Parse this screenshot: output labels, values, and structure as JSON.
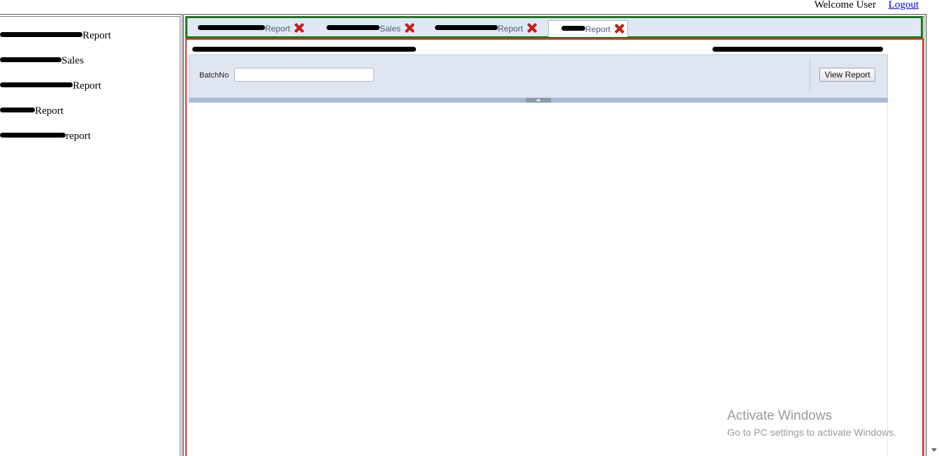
{
  "header": {
    "welcome": "Welcome User",
    "logout": "Logout"
  },
  "sidebar": {
    "items": [
      {
        "label": "Report"
      },
      {
        "label": "Sales"
      },
      {
        "label": "Report"
      },
      {
        "label": "Report"
      },
      {
        "label": "report"
      }
    ]
  },
  "tabs": [
    {
      "label": "Report",
      "active": false
    },
    {
      "label": "Sales",
      "active": false
    },
    {
      "label": "Report",
      "active": false
    },
    {
      "label": "Report",
      "active": true
    }
  ],
  "report": {
    "field_label": "BatchNo",
    "field_value": "",
    "view_button": "View Report"
  },
  "watermark": {
    "title": "Activate Windows",
    "subtitle": "Go to PC settings to activate Windows."
  },
  "colors": {
    "tabstrip_border": "#1a7a1a",
    "content_border": "#d63b3b",
    "close_icon": "#e2231a",
    "link": "#0000ee"
  }
}
